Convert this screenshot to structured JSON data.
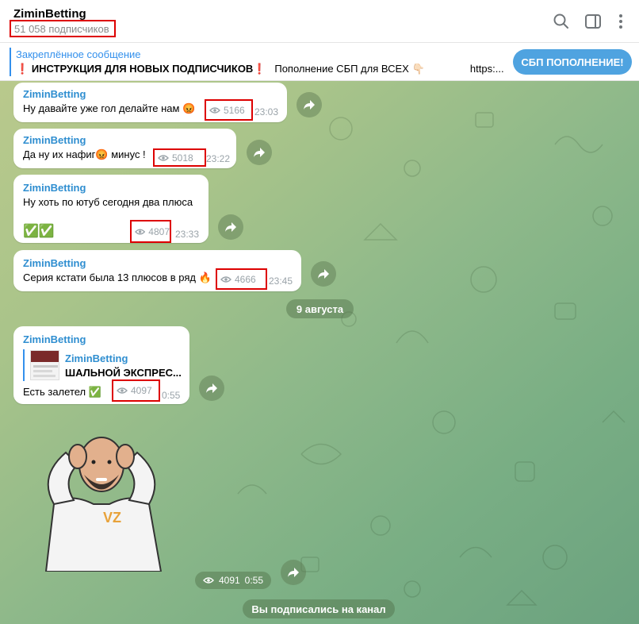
{
  "header": {
    "channel_name": "ZiminBetting",
    "subscribers": "51 058 подписчиков"
  },
  "pinned": {
    "title": "Закреплённое сообщение",
    "text_mark": "❗",
    "text_main": "ИНСТРУКЦИЯ ДЛЯ НОВЫХ ПОДПИСЧИКОВ",
    "text_mark2": "❗",
    "text_rest": "Пополнение СБП для ВСЕХ",
    "text_emoji": "👇🏻",
    "text_link": "https:...",
    "button_label": "СБП ПОПОЛНЕНИЕ!"
  },
  "messages": [
    {
      "author": "ZiminBetting",
      "text": "Ну давайте уже гол делайте нам 😡",
      "views": "5166",
      "time": "23:03"
    },
    {
      "author": "ZiminBetting",
      "text": "Да ну их нафиг😡 минус !",
      "views": "5018",
      "time": "23:22"
    },
    {
      "author": "ZiminBetting",
      "text": "Ну хоть по ютуб сегодня два плюса",
      "text2": "✅✅",
      "views": "4807",
      "time": "23:33"
    },
    {
      "author": "ZiminBetting",
      "text": "Серия кстати была 13 плюсов в ряд 🔥",
      "views": "4666",
      "time": "23:45"
    }
  ],
  "date_separator": "9 августа",
  "forward_message": {
    "author": "ZiminBetting",
    "fwd_author": "ZiminBetting",
    "fwd_text": "ШАЛЬНОЙ ЭКСПРЕС...",
    "text": "Есть залетел ✅",
    "views": "4097",
    "time": "0:55"
  },
  "sticker": {
    "views": "4091",
    "time": "0:55",
    "logo_text": "VZ"
  },
  "footer": {
    "subscribed_label": "Вы подписались на канал"
  },
  "colors": {
    "accent": "#3390ec",
    "author": "#2f8ed0",
    "highlight_box": "#dd0000",
    "button": "#4fa3e0"
  }
}
